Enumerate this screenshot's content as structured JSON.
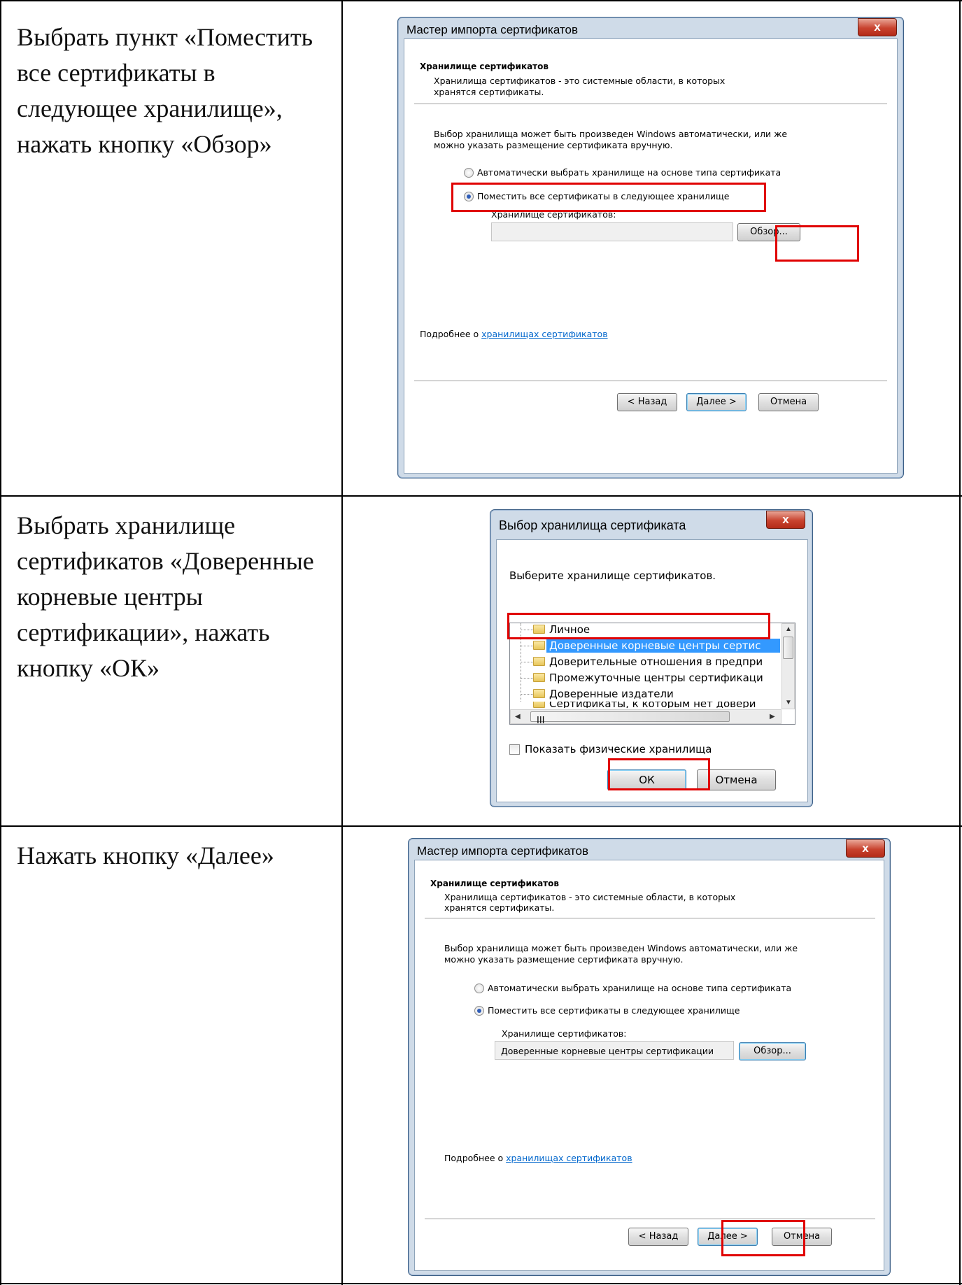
{
  "rows": [
    {
      "instruction_lines": [
        "Выбрать пункт «Поместить",
        "все сертификаты в",
        "следующее хранилище»,",
        "нажать кнопку «Обзор»"
      ]
    },
    {
      "instruction_lines": [
        "Выбрать хранилище",
        "сертификатов «Доверенные",
        "корневые центры",
        "сертификации», нажать",
        "кнопку «ОК»"
      ]
    },
    {
      "instruction_lines": [
        "Нажать кнопку «Далее»"
      ]
    }
  ],
  "wizard1": {
    "title": "Мастер импорта сертификатов",
    "close_label": "x",
    "heading": "Хранилище сертификатов",
    "subheading_lines": [
      "Хранилища сертификатов - это системные области, в которых",
      "хранятся сертификаты."
    ],
    "description_lines": [
      "Выбор хранилища может быть произведен Windows автоматически, или же",
      "можно указать размещение сертификата вручную."
    ],
    "radio_auto": "Автоматически выбрать хранилище на основе типа сертификата",
    "radio_manual": "Поместить все сертификаты в следующее хранилище",
    "store_label": "Хранилище сертификатов:",
    "store_value": "",
    "browse": "Обзор...",
    "more_prefix": "Подробнее о ",
    "more_link": "хранилищах сертификатов",
    "back": "< Назад",
    "next": "Далее >",
    "cancel": "Отмена"
  },
  "store_dialog": {
    "title": "Выбор хранилища сертификата",
    "close_label": "x",
    "prompt": "Выберите хранилище сертификатов.",
    "items": [
      "Личное",
      "Доверенные корневые центры сертис",
      "Доверительные отношения в предпри",
      "Промежуточные центры сертификаци",
      "Доверенные издатели",
      "Сертификаты, к которым нет довери"
    ],
    "selected_index": 1,
    "hscroll_grip": "III",
    "show_physical": "Показать физические хранилища",
    "ok": "ОК",
    "cancel": "Отмена"
  },
  "wizard2": {
    "title": "Мастер импорта сертификатов",
    "close_label": "x",
    "heading": "Хранилище сертификатов",
    "subheading_lines": [
      "Хранилища сертификатов - это системные области, в которых",
      "хранятся сертификаты."
    ],
    "description_lines": [
      "Выбор хранилища может быть произведен Windows автоматически, или же",
      "можно указать размещение сертификата вручную."
    ],
    "radio_auto": "Автоматически выбрать хранилище на основе типа сертификата",
    "radio_manual": "Поместить все сертификаты в следующее хранилище",
    "store_label": "Хранилище сертификатов:",
    "store_value": "Доверенные корневые центры сертификации",
    "browse": "Обзор...",
    "more_prefix": "Подробнее о ",
    "more_link": "хранилищах сертификатов",
    "back": "< Назад",
    "next": "Далее >",
    "cancel": "Отмена"
  }
}
